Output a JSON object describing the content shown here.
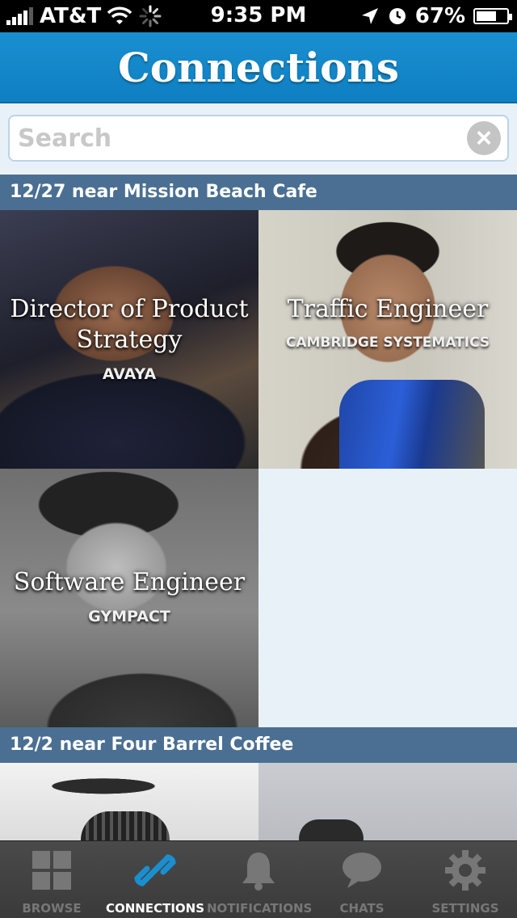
{
  "status_bar": {
    "carrier": "AT&T",
    "time": "9:35 PM",
    "battery": "67%",
    "battery_level": 0.67
  },
  "header": {
    "title": "Connections"
  },
  "search": {
    "placeholder": "Search",
    "value": ""
  },
  "sections": [
    {
      "label": "12/27 near Mission Beach Cafe",
      "connections": [
        {
          "title": "Director of Product Strategy",
          "company": "AVAYA"
        },
        {
          "title": "Traffic Engineer",
          "company": "CAMBRIDGE SYSTEMATICS"
        },
        {
          "title": "Software Engineer",
          "company": "GYMPACT"
        }
      ]
    },
    {
      "label": "12/2 near Four Barrel Coffee",
      "connections": []
    }
  ],
  "tab_bar": {
    "tabs": [
      {
        "label": "BROWSE",
        "icon": "grid-icon",
        "active": false
      },
      {
        "label": "CONNECTIONS",
        "icon": "link-icon",
        "active": true
      },
      {
        "label": "NOTIFICATIONS",
        "icon": "bell-icon",
        "active": false
      },
      {
        "label": "CHATS",
        "icon": "chat-bubble-icon",
        "active": false
      },
      {
        "label": "SETTINGS",
        "icon": "gear-icon",
        "active": false
      }
    ]
  },
  "colors": {
    "header_blue": "#0e7fc2",
    "section_header": "#4a6f92",
    "tab_bar": "#3a3a3a",
    "active_tab_icon": "#1a8fd0"
  }
}
